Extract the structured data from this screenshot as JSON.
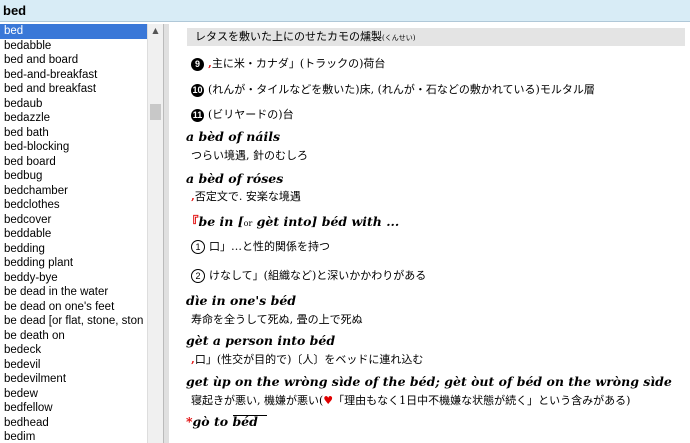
{
  "search": {
    "value": "bed"
  },
  "wordlist": [
    "bed",
    "bedabble",
    "bed and board",
    "bed-and-breakfast",
    "bed and breakfast",
    "bedaub",
    "bedazzle",
    "bed bath",
    "bed-blocking",
    "bed board",
    "bedbug",
    "bedchamber",
    "bedclothes",
    "bedcover",
    "beddable",
    "bedding",
    "bedding plant",
    "beddy-bye",
    "be dead in the water",
    "be dead on one's feet",
    "be dead [or flat, stone, ston",
    "be death on",
    "bedeck",
    "bedevil",
    "bedevilment",
    "bedew",
    "bedfellow",
    "bedhead",
    "bedim"
  ],
  "entry": {
    "header_text": "レタスを敷いた上にのせたカモの燻製",
    "header_reading": "(くんせい)",
    "sense9_num": "9",
    "sense9_text": "主に米・カナダ」(トラックの)荷台",
    "sense10_num": "10",
    "sense10_text": "(れんが・タイルなどを敷いた)床, (れんが・石などの敷かれている)モルタル層",
    "sense11_num": "11",
    "sense11_text": "(ビリヤードの)台",
    "p1": "a bèd of náils",
    "p1_def": "つらい境遇, 針のむしろ",
    "p2": "a bèd of róses",
    "p2_def": "否定文で. 安楽な境遇",
    "p3a": "be in [",
    "p3_or": "or",
    "p3b": " gèt into] béd with ...",
    "p3_s1_num": "1",
    "p3_s1": "口」…と性的関係を持つ",
    "p3_s2_num": "2",
    "p3_s2": "けなして」(組織など)と深いかかわりがある",
    "p4": "dìe in one's béd",
    "p4_def": "寿命を全うして死ぬ, 畳の上で死ぬ",
    "p5": "gèt a person into béd",
    "p5_def": "口」(性交が目的で)〔人〕をベッドに連れ込む",
    "p6": "get ùp on the wròng sìde of the béd; gèt òut of béd on the wròng sìde",
    "p6_def_a": "寝起きが悪い, 機嫌が悪い(",
    "p6_def_b": "「理由もなく1日中不機嫌な状態が続く」という含みがある)",
    "p7": "gò to béd"
  },
  "colors": {
    "selection": "#3a78d8",
    "search_bg": "#d8ecf6",
    "marker": "#e00000"
  }
}
